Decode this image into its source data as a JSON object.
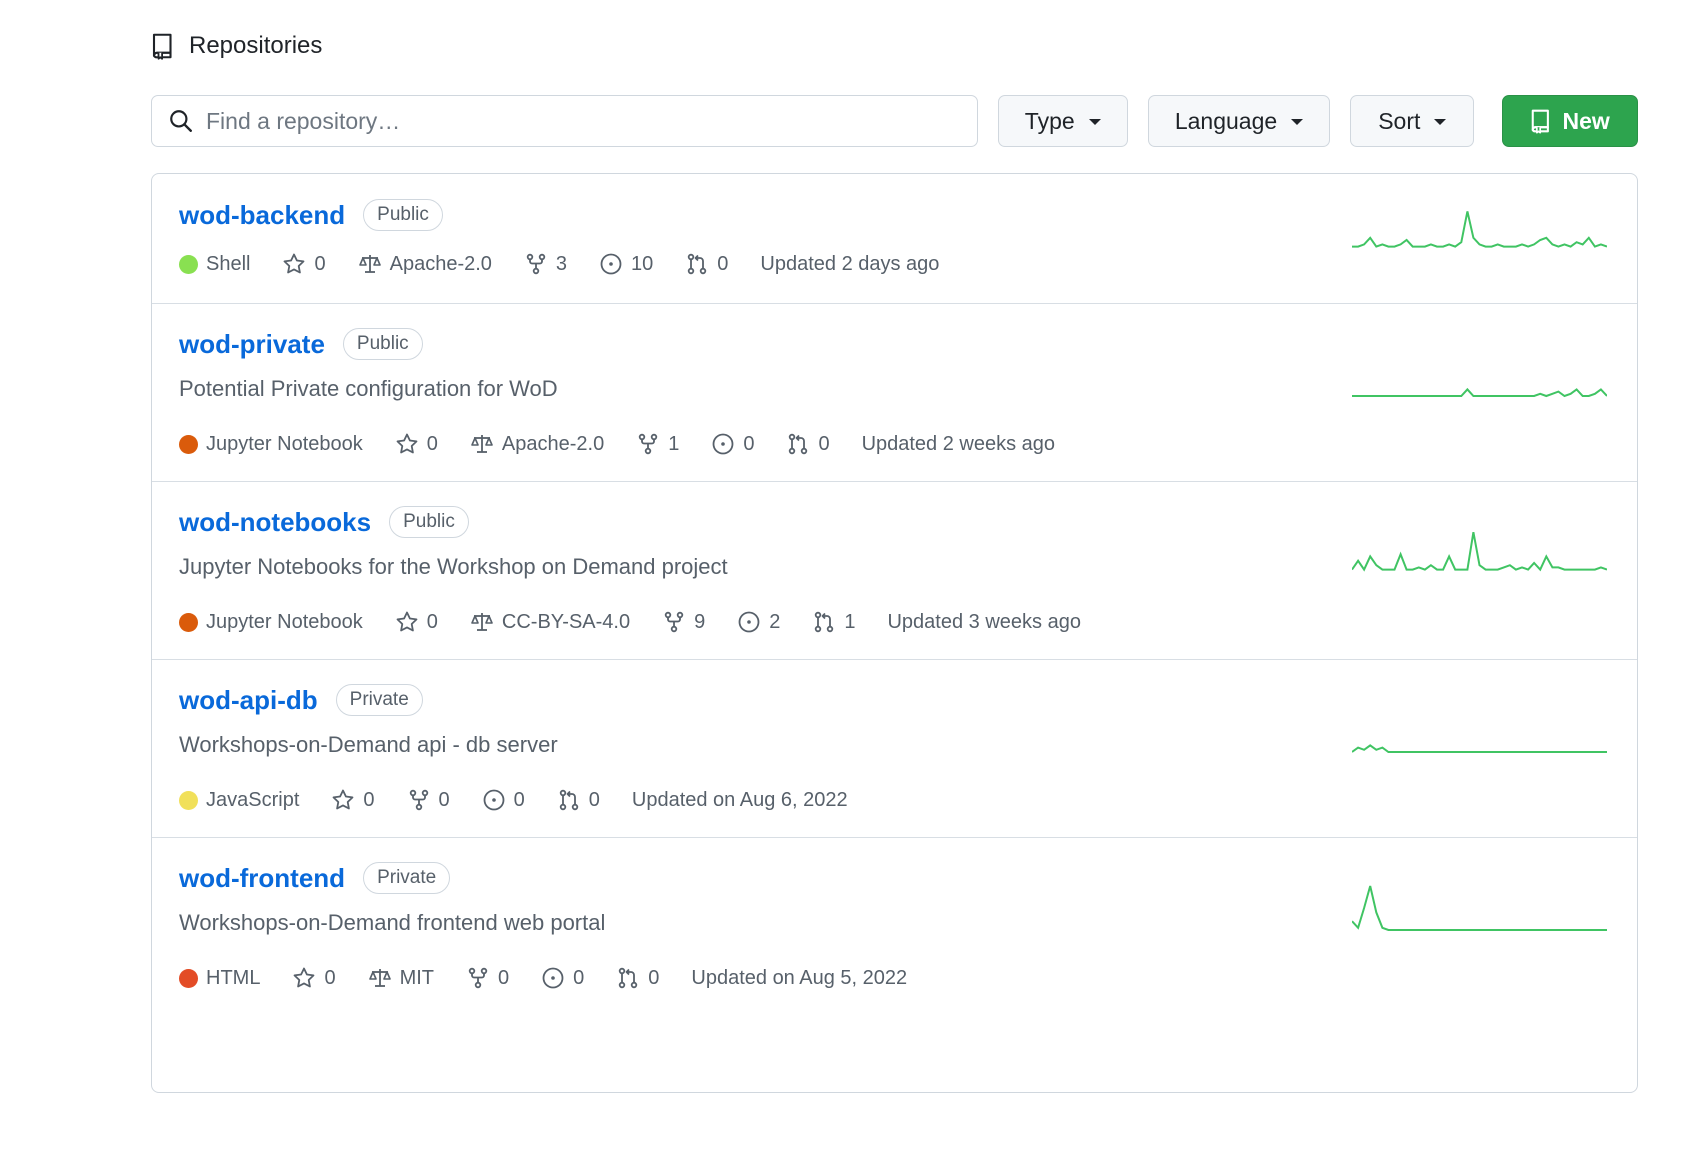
{
  "header": {
    "title": "Repositories",
    "icon": "repo-icon"
  },
  "toolbar": {
    "search_placeholder": "Find a repository…",
    "type_label": "Type",
    "language_label": "Language",
    "sort_label": "Sort",
    "new_label": "New"
  },
  "colors": {
    "accent_link": "#0969da",
    "new_button": "#2da44e",
    "sparkline": "#40c463"
  },
  "repos": [
    {
      "name": "wod-backend",
      "visibility": "Public",
      "description": "",
      "language": "Shell",
      "language_color": "#89e051",
      "stars": "0",
      "license": "Apache-2.0",
      "forks": "3",
      "issues": "10",
      "pulls": "0",
      "updated": "Updated 2 days ago",
      "activity": [
        2,
        2,
        3,
        6,
        2,
        3,
        2,
        2,
        3,
        5,
        2,
        2,
        2,
        3,
        2,
        2,
        3,
        2,
        4,
        18,
        6,
        3,
        2,
        2,
        3,
        2,
        2,
        2,
        3,
        2,
        3,
        5,
        6,
        3,
        2,
        3,
        2,
        4,
        3,
        6,
        2,
        3,
        2
      ]
    },
    {
      "name": "wod-private",
      "visibility": "Public",
      "description": "Potential Private configuration for WoD",
      "language": "Jupyter Notebook",
      "language_color": "#DA5B0B",
      "stars": "0",
      "license": "Apache-2.0",
      "forks": "1",
      "issues": "0",
      "pulls": "0",
      "updated": "Updated 2 weeks ago",
      "activity": [
        0,
        0,
        0,
        0,
        0,
        0,
        0,
        0,
        0,
        0,
        0,
        0,
        0,
        0,
        0,
        0,
        0,
        0,
        0,
        3,
        0,
        0,
        0,
        0,
        0,
        0,
        0,
        0,
        0,
        0,
        0,
        1,
        0,
        1,
        2,
        0,
        1,
        3,
        0,
        0,
        1,
        3,
        0
      ]
    },
    {
      "name": "wod-notebooks",
      "visibility": "Public",
      "description": "Jupyter Notebooks for the Workshop on Demand project",
      "language": "Jupyter Notebook",
      "language_color": "#DA5B0B",
      "stars": "0",
      "license": "CC-BY-SA-4.0",
      "forks": "9",
      "issues": "2",
      "pulls": "1",
      "updated": "Updated 3 weeks ago",
      "activity": [
        2,
        6,
        2,
        8,
        4,
        2,
        2,
        2,
        9,
        2,
        2,
        3,
        2,
        4,
        2,
        2,
        8,
        2,
        2,
        2,
        19,
        4,
        2,
        2,
        2,
        3,
        4,
        2,
        3,
        2,
        5,
        2,
        8,
        3,
        3,
        2,
        2,
        2,
        2,
        2,
        2,
        3,
        2
      ]
    },
    {
      "name": "wod-api-db",
      "visibility": "Private",
      "description": "Workshops-on-Demand api - db server",
      "language": "JavaScript",
      "language_color": "#f1e05a",
      "stars": "0",
      "license": "",
      "forks": "0",
      "issues": "0",
      "pulls": "0",
      "updated": "Updated on Aug 6, 2022",
      "activity": [
        0,
        2,
        1,
        3,
        1,
        2,
        0,
        0,
        0,
        0,
        0,
        0,
        0,
        0,
        0,
        0,
        0,
        0,
        0,
        0,
        0,
        0,
        0,
        0,
        0,
        0,
        0,
        0,
        0,
        0,
        0,
        0,
        0,
        0,
        0,
        0,
        0,
        0,
        0,
        0,
        0,
        0,
        0
      ]
    },
    {
      "name": "wod-frontend",
      "visibility": "Private",
      "description": "Workshops-on-Demand frontend web portal",
      "language": "HTML",
      "language_color": "#e34c26",
      "stars": "0",
      "license": "MIT",
      "forks": "0",
      "issues": "0",
      "pulls": "0",
      "updated": "Updated on Aug 5, 2022",
      "activity": [
        4,
        1,
        10,
        20,
        8,
        1,
        0,
        0,
        0,
        0,
        0,
        0,
        0,
        0,
        0,
        0,
        0,
        0,
        0,
        0,
        0,
        0,
        0,
        0,
        0,
        0,
        0,
        0,
        0,
        0,
        0,
        0,
        0,
        0,
        0,
        0,
        0,
        0,
        0,
        0,
        0,
        0,
        0
      ]
    }
  ]
}
